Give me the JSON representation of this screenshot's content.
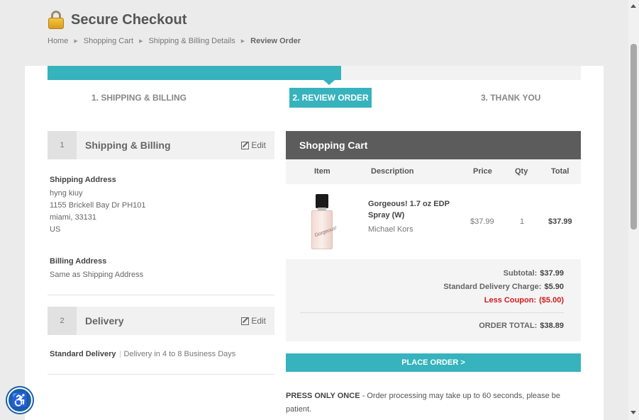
{
  "header": {
    "title": "Secure Checkout",
    "breadcrumb": [
      "Home",
      "Shopping Cart",
      "Shipping & Billing Details",
      "Review Order"
    ]
  },
  "steps": [
    "1. SHIPPING & BILLING",
    "2. REVIEW ORDER",
    "3. THANK YOU"
  ],
  "shipping_billing": {
    "number": "1",
    "title": "Shipping & Billing",
    "edit_label": "Edit",
    "shipping_address_heading": "Shipping Address",
    "shipping_lines": [
      "hyng kiuy",
      "1155 Brickell Bay Dr PH101",
      "miami, 33131",
      "US"
    ],
    "billing_address_heading": "Billing Address",
    "billing_text": "Same as Shipping Address"
  },
  "delivery": {
    "number": "2",
    "title": "Delivery",
    "edit_label": "Edit",
    "method": "Standard Delivery",
    "eta": "Delivery in 4 to 8 Business Days"
  },
  "cart": {
    "title": "Shopping Cart",
    "columns": [
      "Item",
      "Description",
      "Price",
      "Qty",
      "Total"
    ],
    "item": {
      "description": "Gorgeous! 1.7 oz EDP Spray (W)",
      "brand": "Michael Kors",
      "price": "$37.99",
      "qty": "1",
      "total": "$37.99",
      "image_text": "Gorgeous!"
    },
    "summary": {
      "subtotal_label": "Subtotal:",
      "subtotal": "$37.99",
      "delivery_label": "Standard Delivery Charge:",
      "delivery": "$5.90",
      "coupon_label": "Less Coupon:",
      "coupon": "($5.00)",
      "order_total_label": "ORDER TOTAL:",
      "order_total": "$38.89"
    },
    "place_order_label": "PLACE ORDER >",
    "note_bold": "PRESS ONLY ONCE",
    "note_text": " - Order processing may take up to 60 seconds, please be patient."
  },
  "colors": {
    "accent": "#36b3bd",
    "cart_header": "#5c5c5c",
    "coupon": "#d21b1b",
    "accessibility": "#1b5fa8"
  },
  "icons": {
    "title": "lock-icon",
    "edit": "pencil-icon",
    "accessibility": "accessibility-icon"
  }
}
